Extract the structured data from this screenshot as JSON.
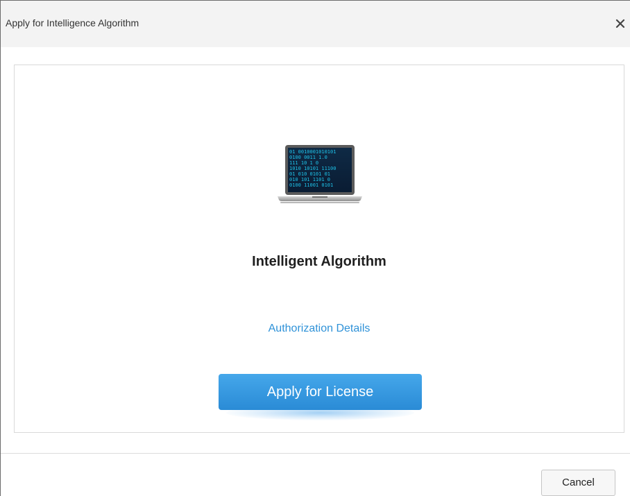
{
  "dialog": {
    "title": "Apply for Intelligence Algorithm",
    "close_symbol": "×"
  },
  "content": {
    "image_icon": "laptop-binary-icon",
    "heading": "Intelligent Algorithm",
    "auth_link": "Authorization Details",
    "apply_button": "Apply for License"
  },
  "footer": {
    "cancel_button": "Cancel"
  },
  "colors": {
    "title_bar": "#f3f3f3",
    "link": "#2f92d8",
    "primary_button": "#2a8bd6"
  }
}
